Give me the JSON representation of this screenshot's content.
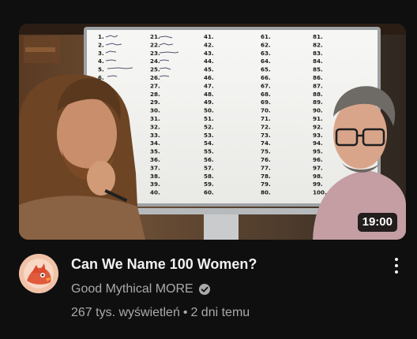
{
  "video": {
    "duration": "19:00",
    "title": "Can We Name 100 Women?",
    "channel": "Good Mythical MORE",
    "channel_verified": true,
    "views": "267 tys. wyświetleń",
    "separator": "•",
    "age": "2 dni temu"
  },
  "whiteboard": {
    "col1": [
      "1.",
      "2.",
      "3.",
      "4.",
      "5.",
      "6.",
      "7.",
      "8.",
      "9.",
      "10.",
      "11.",
      "12.",
      "13.",
      "14.",
      "15.",
      "16.",
      "17.",
      "18.",
      "19.",
      "20."
    ],
    "col2": [
      "21.",
      "22.",
      "23.",
      "24.",
      "25.",
      "26.",
      "27.",
      "28.",
      "29.",
      "30.",
      "31.",
      "32.",
      "33.",
      "34.",
      "35.",
      "36.",
      "37.",
      "38.",
      "39.",
      "40."
    ],
    "col3": [
      "41.",
      "42.",
      "43.",
      "44.",
      "45.",
      "46.",
      "47.",
      "48.",
      "49.",
      "50.",
      "51.",
      "52.",
      "53.",
      "54.",
      "55.",
      "56.",
      "57.",
      "58.",
      "59.",
      "60."
    ],
    "col4": [
      "61.",
      "62.",
      "63.",
      "64.",
      "65.",
      "66.",
      "67.",
      "68.",
      "69.",
      "70.",
      "71.",
      "72.",
      "73.",
      "74.",
      "75.",
      "76.",
      "77.",
      "78.",
      "79.",
      "80."
    ],
    "col5": [
      "81.",
      "82.",
      "83.",
      "84.",
      "85.",
      "86.",
      "87.",
      "88.",
      "89.",
      "90.",
      "91.",
      "92.",
      "93.",
      "94.",
      "95.",
      "96.",
      "97.",
      "98.",
      "99.",
      "100."
    ]
  },
  "icons": {
    "more": "vertical-dots-icon",
    "verified": "check-circle-icon",
    "avatar": "channel-avatar-icon"
  },
  "colors": {
    "background": "#0f0f0f",
    "text_primary": "#f1f1f1",
    "text_secondary": "#aaaaaa",
    "duration_bg": "#000000"
  }
}
